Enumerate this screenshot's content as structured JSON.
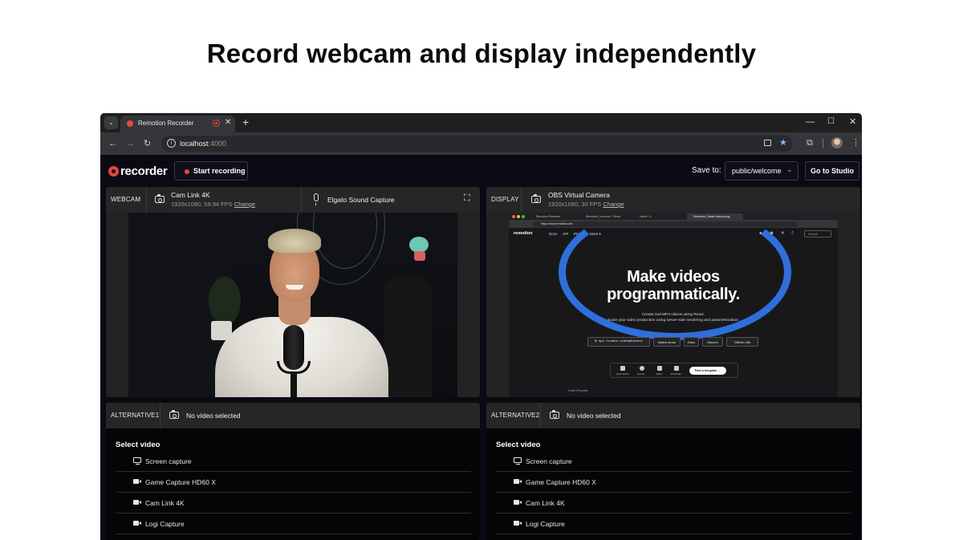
{
  "headline": "Record webcam and display independently",
  "browser": {
    "tab_title": "Remotion Recorder",
    "new_tab": "+",
    "host": "localhost",
    "port": ":4000"
  },
  "app": {
    "logo": "recorder",
    "start_recording": "Start recording",
    "save_to_label": "Save to:",
    "save_to_value": "public/welcome",
    "go_to_studio": "Go to Studio"
  },
  "webcam": {
    "label": "WEBCAM",
    "source": "Cam Link 4K",
    "meta": "1920x1080, 59.94 FPS",
    "change": "Change",
    "audio_source": "Elgato Sound Capture"
  },
  "display": {
    "label": "DISPLAY",
    "source": "OBS Virtual Camera",
    "meta": "1920x1080, 30 FPS",
    "change": "Change",
    "capture": {
      "tabs": [
        "Remotion Recorder",
        "Remotion | recorder - Remo",
        "Home / X",
        "Remotion | Make videos prog"
      ],
      "url": "https://www.remotion.dev",
      "logo": "remotion",
      "nav": [
        "Docs",
        "API",
        "Pricing",
        "More ▾"
      ],
      "search": "Search",
      "hero_line1": "Make videos",
      "hero_line2": "programmatically.",
      "sub_line1": "Create real MP4 videos using React.",
      "sub_line2": "Scale your video production using server-side rendering and parametrization.",
      "cmd": "$ npx create-video@latest",
      "buttons": [
        "Watch demo",
        "Docs",
        "Discord",
        "GitHub 18k"
      ],
      "templates": [
        "Hello World",
        "Next.js",
        "Blank",
        "JavaScript"
      ],
      "find_template": "Find a template →",
      "code_preview": "Code | Preview"
    }
  },
  "alt1": {
    "label": "ALTERNATIVE1",
    "status": "No video selected",
    "list_title": "Select video",
    "items": [
      "Screen capture",
      "Game Capture HD60 X",
      "Cam Link 4K",
      "Logi Capture"
    ]
  },
  "alt2": {
    "label": "ALTERNATIVE2",
    "status": "No video selected",
    "list_title": "Select video",
    "items": [
      "Screen capture",
      "Game Capture HD60 X",
      "Cam Link 4K",
      "Logi Capture"
    ]
  },
  "colors": {
    "accent_red": "#e8483a",
    "remotion_blue": "#2f6fdb",
    "app_bg": "#0a0a14",
    "panel_bg": "#232323"
  }
}
